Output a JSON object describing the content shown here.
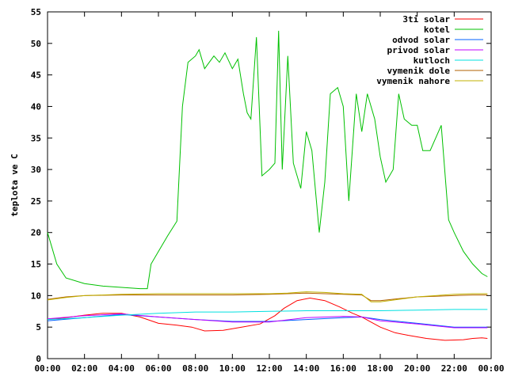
{
  "chart_data": {
    "type": "line",
    "title": "",
    "xlabel": "",
    "ylabel": "teplota ve C",
    "xlim": [
      "00:00",
      "24:00"
    ],
    "ylim": [
      0,
      55
    ],
    "grid": false,
    "legend_position": "top-right",
    "x_ticks": [
      "00:00",
      "02:00",
      "04:00",
      "06:00",
      "08:00",
      "10:00",
      "12:00",
      "14:00",
      "16:00",
      "18:00",
      "20:00",
      "22:00",
      "00:00"
    ],
    "y_ticks": [
      0,
      5,
      10,
      15,
      20,
      25,
      30,
      35,
      40,
      45,
      50,
      55
    ],
    "series": [
      {
        "name": "3ti solar",
        "color": "#ff0000",
        "x": [
          0,
          1,
          2,
          3,
          4,
          5,
          6,
          7,
          7.8,
          8.5,
          9.5,
          10.5,
          11.5,
          12.3,
          12.8,
          13.5,
          14.2,
          15,
          15.8,
          16.5,
          17,
          17.5,
          18,
          18.8,
          19.5,
          20.5,
          21.5,
          22.5,
          23,
          23.5,
          23.8
        ],
        "y": [
          6.2,
          6.5,
          6.9,
          7.2,
          7.2,
          6.6,
          5.6,
          5.3,
          5.0,
          4.4,
          4.5,
          5.0,
          5.5,
          6.8,
          8.0,
          9.2,
          9.6,
          9.2,
          8.2,
          7.2,
          6.6,
          5.8,
          5.0,
          4.1,
          3.7,
          3.2,
          2.9,
          3.0,
          3.2,
          3.3,
          3.2
        ]
      },
      {
        "name": "kotel",
        "color": "#00c000",
        "x": [
          0,
          0.5,
          1,
          2,
          3,
          4,
          5,
          5.4,
          5.6,
          6,
          6.5,
          7,
          7.3,
          7.6,
          8,
          8.2,
          8.5,
          9,
          9.3,
          9.6,
          10,
          10.3,
          10.6,
          10.8,
          11,
          11.3,
          11.6,
          12,
          12.3,
          12.5,
          12.7,
          13,
          13.3,
          13.7,
          14,
          14.3,
          14.7,
          15,
          15.3,
          15.7,
          16,
          16.3,
          16.7,
          17,
          17.3,
          17.7,
          18,
          18.3,
          18.7,
          19,
          19.3,
          19.7,
          20,
          20.3,
          20.7,
          21,
          21.3,
          21.7,
          22,
          22.5,
          23,
          23.5,
          23.8
        ],
        "y": [
          20,
          15,
          12.8,
          11.9,
          11.5,
          11.3,
          11.1,
          11.1,
          15,
          17,
          19.5,
          21.8,
          40,
          47,
          48,
          49,
          46,
          48,
          47,
          48.5,
          46,
          47.5,
          42,
          39,
          38,
          51,
          29,
          30,
          31,
          52,
          30,
          48,
          31,
          27,
          36,
          33,
          20,
          28,
          42,
          43,
          40,
          25,
          42,
          36,
          42,
          38,
          32,
          28,
          30,
          42,
          38,
          37,
          37,
          33,
          33,
          35,
          37,
          22,
          20,
          17,
          15,
          13.5,
          13
        ]
      },
      {
        "name": "odvod solar",
        "color": "#0060ff",
        "x": [
          0,
          2,
          4,
          6,
          8,
          10,
          12,
          14,
          16,
          17,
          18,
          20,
          22,
          23.8
        ],
        "y": [
          6.0,
          6.5,
          7.0,
          6.6,
          6.2,
          5.9,
          5.9,
          6.2,
          6.5,
          6.6,
          6.2,
          5.6,
          5.0,
          5.0
        ]
      },
      {
        "name": "privod solar",
        "color": "#c000ff",
        "x": [
          0,
          2,
          4,
          6,
          8,
          10,
          12,
          14,
          16,
          17,
          18,
          20,
          22,
          23.8
        ],
        "y": [
          6.3,
          6.8,
          7.1,
          6.6,
          6.2,
          5.8,
          5.8,
          6.5,
          6.7,
          6.6,
          6.0,
          5.5,
          4.9,
          4.9
        ]
      },
      {
        "name": "kutloch",
        "color": "#00e0e0",
        "x": [
          0,
          2,
          4,
          6,
          8,
          10,
          12,
          14,
          16,
          17,
          18,
          20,
          22,
          23.8
        ],
        "y": [
          6.2,
          6.5,
          6.9,
          7.2,
          7.4,
          7.4,
          7.5,
          7.6,
          7.6,
          7.6,
          7.6,
          7.7,
          7.8,
          7.8
        ]
      },
      {
        "name": "vymenik dole",
        "color": "#b06000",
        "x": [
          0,
          1,
          2,
          4,
          6,
          8,
          10,
          12,
          13,
          14,
          15,
          16,
          17,
          17.5,
          18,
          19,
          20,
          21,
          22,
          23,
          23.8
        ],
        "y": [
          9.4,
          9.8,
          10.0,
          10.1,
          10.1,
          10.1,
          10.1,
          10.2,
          10.3,
          10.4,
          10.3,
          10.2,
          10.1,
          9.2,
          9.2,
          9.5,
          9.8,
          9.9,
          10.0,
          10.1,
          10.1
        ]
      },
      {
        "name": "vymenik nahore",
        "color": "#c0b000",
        "x": [
          0,
          1,
          2,
          4,
          6,
          8,
          10,
          12,
          13,
          14,
          15,
          16,
          17,
          17.5,
          18,
          19,
          20,
          21,
          22,
          23,
          23.8
        ],
        "y": [
          9.3,
          9.7,
          10.0,
          10.2,
          10.3,
          10.3,
          10.3,
          10.3,
          10.4,
          10.6,
          10.5,
          10.3,
          10.2,
          9.0,
          9.0,
          9.4,
          9.8,
          10.0,
          10.2,
          10.3,
          10.3
        ]
      }
    ]
  }
}
